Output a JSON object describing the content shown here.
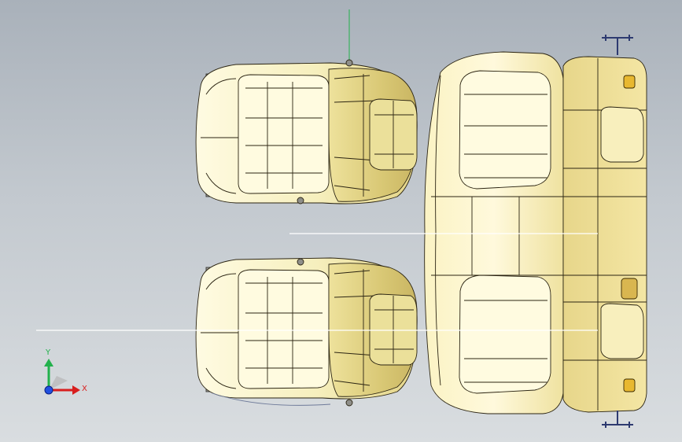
{
  "colors": {
    "background_top": "#a9b1ba",
    "background_bottom": "#d9dde0",
    "seat_fill": "#f6efbd",
    "seat_fill_light": "#fffbe0",
    "seat_shadow": "#d8c676",
    "headrest_fill": "#ebe09a",
    "edge_line": "#2b2412",
    "axis_x": "#d81e1e",
    "axis_y": "#22b14c",
    "axis_z": "#2050e0"
  },
  "scene": {
    "front_seats": [
      {
        "name": "front-seat-left"
      },
      {
        "name": "front-seat-right"
      }
    ],
    "rear_bench": {
      "name": "rear-bench-seat"
    },
    "sections": [
      "section-line-upper",
      "section-line-lower"
    ]
  },
  "triad": {
    "x_label": "X",
    "y_label": "Y"
  }
}
